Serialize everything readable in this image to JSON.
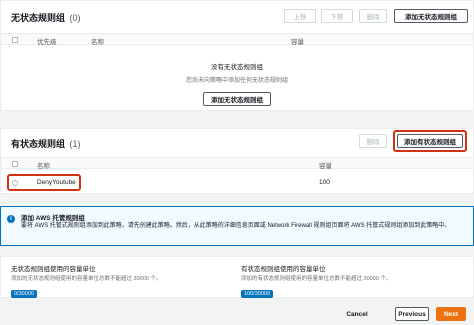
{
  "stateless": {
    "title": "无状态规则组",
    "count": "(0)",
    "buttons": {
      "move_up": "上移",
      "move_down": "下移",
      "delete": "删除",
      "add": "添加无状态规则组"
    },
    "columns": [
      "优先级",
      "名称",
      "容量"
    ],
    "empty_title": "没有无状态规则组",
    "empty_desc": "您尚未向策略中添加任何无状态规则组",
    "empty_add": "添加无状态规则组"
  },
  "stateful": {
    "title": "有状态规则组",
    "count": "(1)",
    "buttons": {
      "delete": "删除",
      "add": "添加有状态规则组"
    },
    "columns": [
      "名称",
      "容量"
    ],
    "rows": [
      {
        "name": "DenyYoutube",
        "capacity": "100"
      }
    ]
  },
  "info": {
    "title": "添加 AWS 托管规则组",
    "body": "要将 AWS 托管式规则组添加到此策略，请先创建此策略。然后，从此策略的详细信息页面或 Network Firewall 规则组页面将 AWS 托管式规则组添加到此策略中。"
  },
  "capacity": {
    "stateless_title": "无状态规则组使用的容量单位",
    "stateless_desc": "添加的无状态规则组使用的容量单位总数不能超过 30000 个。",
    "stateless_value": "0/30000",
    "stateful_title": "有状态规则组使用的容量单位",
    "stateful_desc": "添加的有状态规则组使用的容量单位总数不能超过 30000 个。",
    "stateful_value": "100/30000"
  },
  "footer": {
    "cancel": "Cancel",
    "previous": "Previous",
    "next": "Next"
  },
  "colors": {
    "primary": "#ec7211",
    "info": "#0073bb",
    "highlight": "#d13212"
  }
}
